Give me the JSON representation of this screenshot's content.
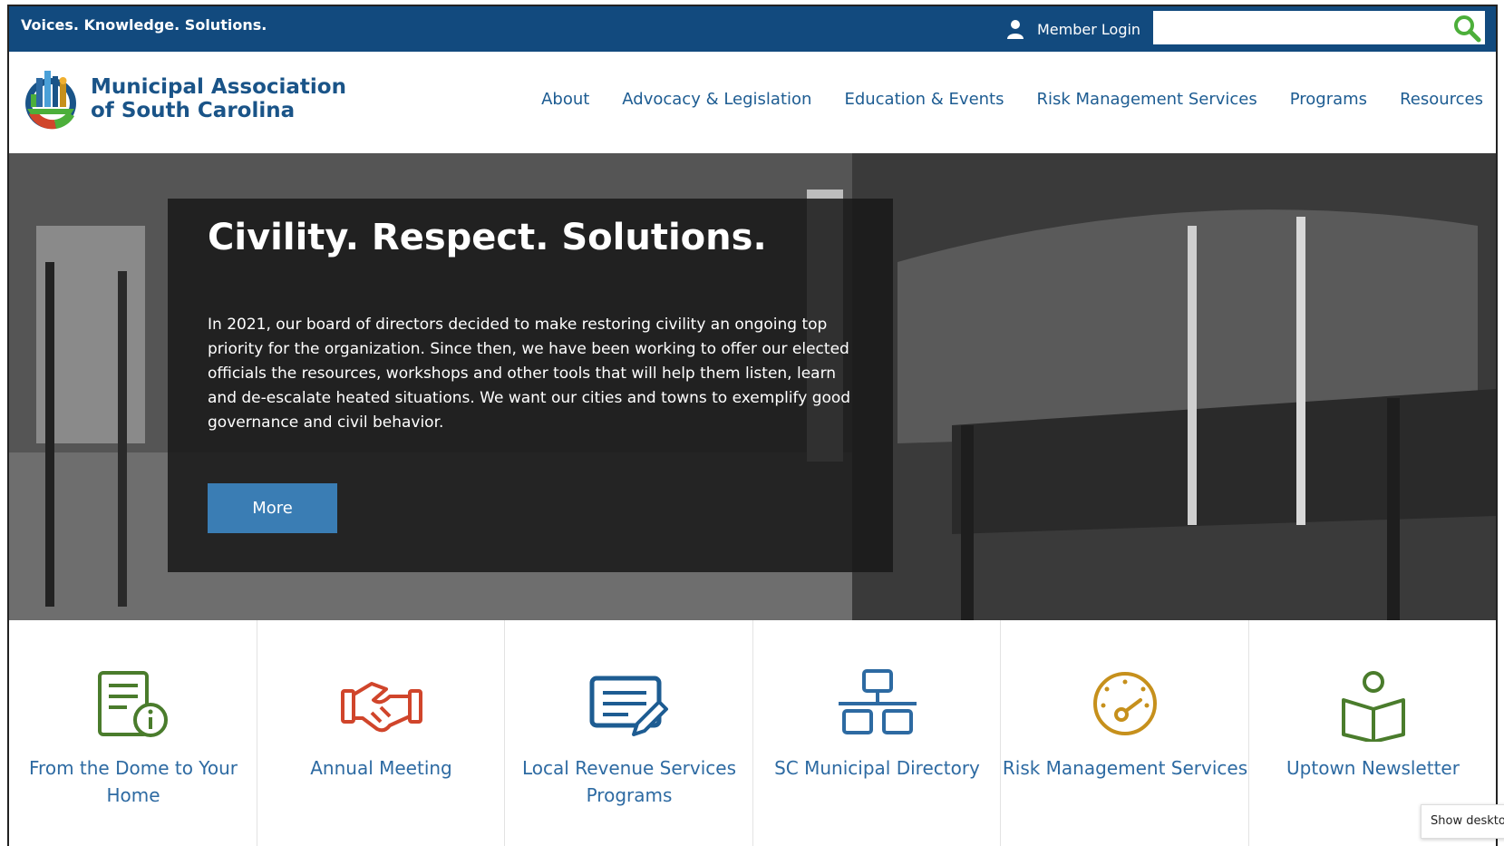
{
  "topbar": {
    "tagline": "Voices. Knowledge. Solutions.",
    "login_label": "Member Login",
    "search_placeholder": ""
  },
  "brand": {
    "name_line1": "Municipal Association",
    "name_line2": "of South Carolina"
  },
  "nav": [
    "About",
    "Advocacy & Legislation",
    "Education & Events",
    "Risk Management Services",
    "Programs",
    "Resources"
  ],
  "hero": {
    "title": "Civility. Respect. Solutions.",
    "body": "In 2021, our board of directors decided to make restoring civility an ongoing top priority for the organization. Since then, we have been working to offer our elected officials the resources, workshops and other tools that will help them listen, learn and de-escalate heated situations. We want our cities and towns to exemplify good governance and civil behavior.",
    "button": "More"
  },
  "cards": [
    {
      "label": "From the Dome to Your Home",
      "icon": "document-info-icon",
      "color": "#4a7c2c"
    },
    {
      "label": "Annual Meeting",
      "icon": "handshake-icon",
      "color": "#d0452b"
    },
    {
      "label": "Local Revenue Services Programs",
      "icon": "form-pencil-icon",
      "color": "#1d5c92"
    },
    {
      "label": "SC Municipal Directory",
      "icon": "org-chart-icon",
      "color": "#2d6aa2"
    },
    {
      "label": "Risk Management Services",
      "icon": "gauge-icon",
      "color": "#c6901c"
    },
    {
      "label": "Uptown Newsletter",
      "icon": "reader-book-icon",
      "color": "#4a7c2c"
    }
  ],
  "tooltip": "Show deskto",
  "colors": {
    "topbar": "#124a7e",
    "nav_link": "#1d5c92",
    "button": "#3a7db4",
    "search_icon": "#4caf3a"
  }
}
